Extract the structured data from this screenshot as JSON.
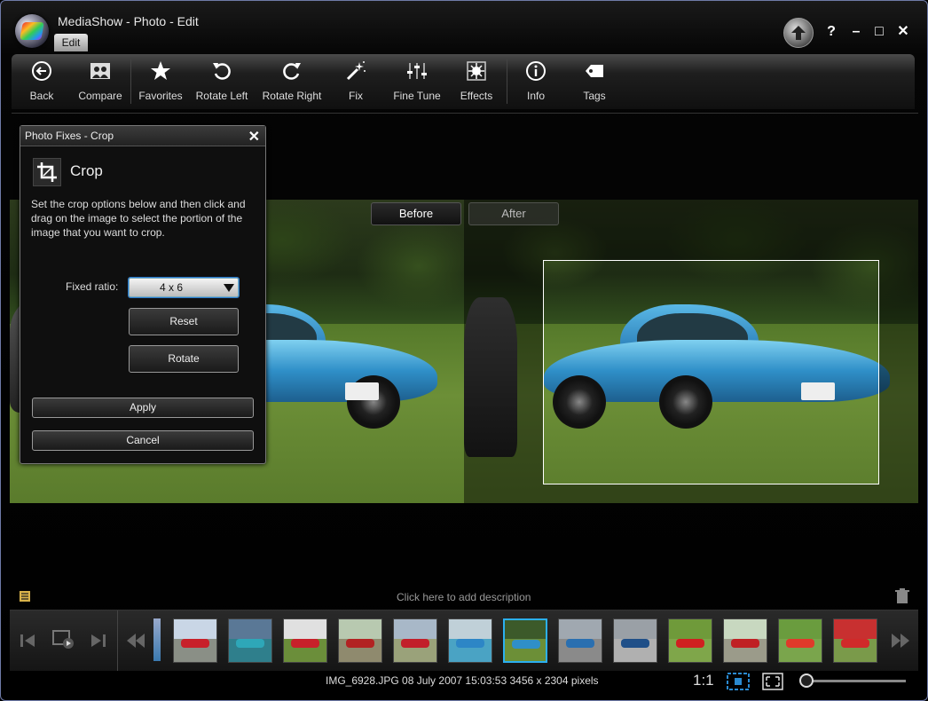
{
  "window": {
    "title": "MediaShow - Photo - Edit",
    "active_tab": "Edit"
  },
  "title_controls": {
    "help": "?",
    "minimize": "–",
    "maximize": "□",
    "close": "✕"
  },
  "toolbar": {
    "back": "Back",
    "compare": "Compare",
    "favorites": "Favorites",
    "rotate_left": "Rotate Left",
    "rotate_right": "Rotate Right",
    "fix": "Fix",
    "fine_tune": "Fine Tune",
    "effects": "Effects",
    "info": "Info",
    "tags": "Tags"
  },
  "view_tabs": {
    "before": "Before",
    "after": "After"
  },
  "dialog": {
    "title": "Photo Fixes - Crop",
    "close": "✕",
    "heading": "Crop",
    "description": "Set the crop options below and then click and drag on the image to select the portion of the image that you want to crop.",
    "fixed_ratio_label": "Fixed ratio:",
    "fixed_ratio_value": "4 x 6",
    "reset": "Reset",
    "rotate": "Rotate",
    "apply": "Apply",
    "cancel": "Cancel"
  },
  "description_placeholder": "Click here to add description",
  "filmstrip": {
    "thumbnails": [
      {
        "name": "thumb-1",
        "sky": "#c9d6e6",
        "grass": "#8a8f86",
        "car": "#c8202a"
      },
      {
        "name": "thumb-2",
        "sky": "#5a7896",
        "grass": "#2f7f8c",
        "car": "#2ea7b8"
      },
      {
        "name": "thumb-3",
        "sky": "#e0e0e0",
        "grass": "#6b8e3a",
        "car": "#c8202a"
      },
      {
        "name": "thumb-4",
        "sky": "#b8c9b0",
        "grass": "#8f8a6e",
        "car": "#b22222"
      },
      {
        "name": "thumb-5",
        "sky": "#a8b8c8",
        "grass": "#9aa27a",
        "car": "#c21f2a"
      },
      {
        "name": "thumb-6",
        "sky": "#c0d0d8",
        "grass": "#4aa3c4",
        "car": "#2d86c6"
      },
      {
        "name": "thumb-7",
        "sky": "#3c5a2a",
        "grass": "#6c8f37",
        "car": "#2f8fc8",
        "selected": true
      },
      {
        "name": "thumb-8",
        "sky": "#a0a8b0",
        "grass": "#8a8a8a",
        "car": "#2a6fb0"
      },
      {
        "name": "thumb-9",
        "sky": "#9aa0a6",
        "grass": "#b0b0b0",
        "car": "#1f4f88"
      },
      {
        "name": "thumb-10",
        "sky": "#6f9a3a",
        "grass": "#7fa64a",
        "car": "#d02020"
      },
      {
        "name": "thumb-11",
        "sky": "#c8d8c0",
        "grass": "#9b9b8a",
        "car": "#c02024"
      },
      {
        "name": "thumb-12",
        "sky": "#6a9c3e",
        "grass": "#7aa54c",
        "car": "#e03a2a"
      },
      {
        "name": "thumb-13",
        "sky": "#c83030",
        "grass": "#7a9a4a",
        "car": "#d02a2a"
      }
    ]
  },
  "status": {
    "file_info": "IMG_6928.JPG  08 July 2007 15:03:53  3456 x 2304 pixels",
    "ratio": "1:1",
    "zoom_fraction": 0.0
  },
  "colors": {
    "accent": "#2cb0f0",
    "background": "#000000"
  }
}
